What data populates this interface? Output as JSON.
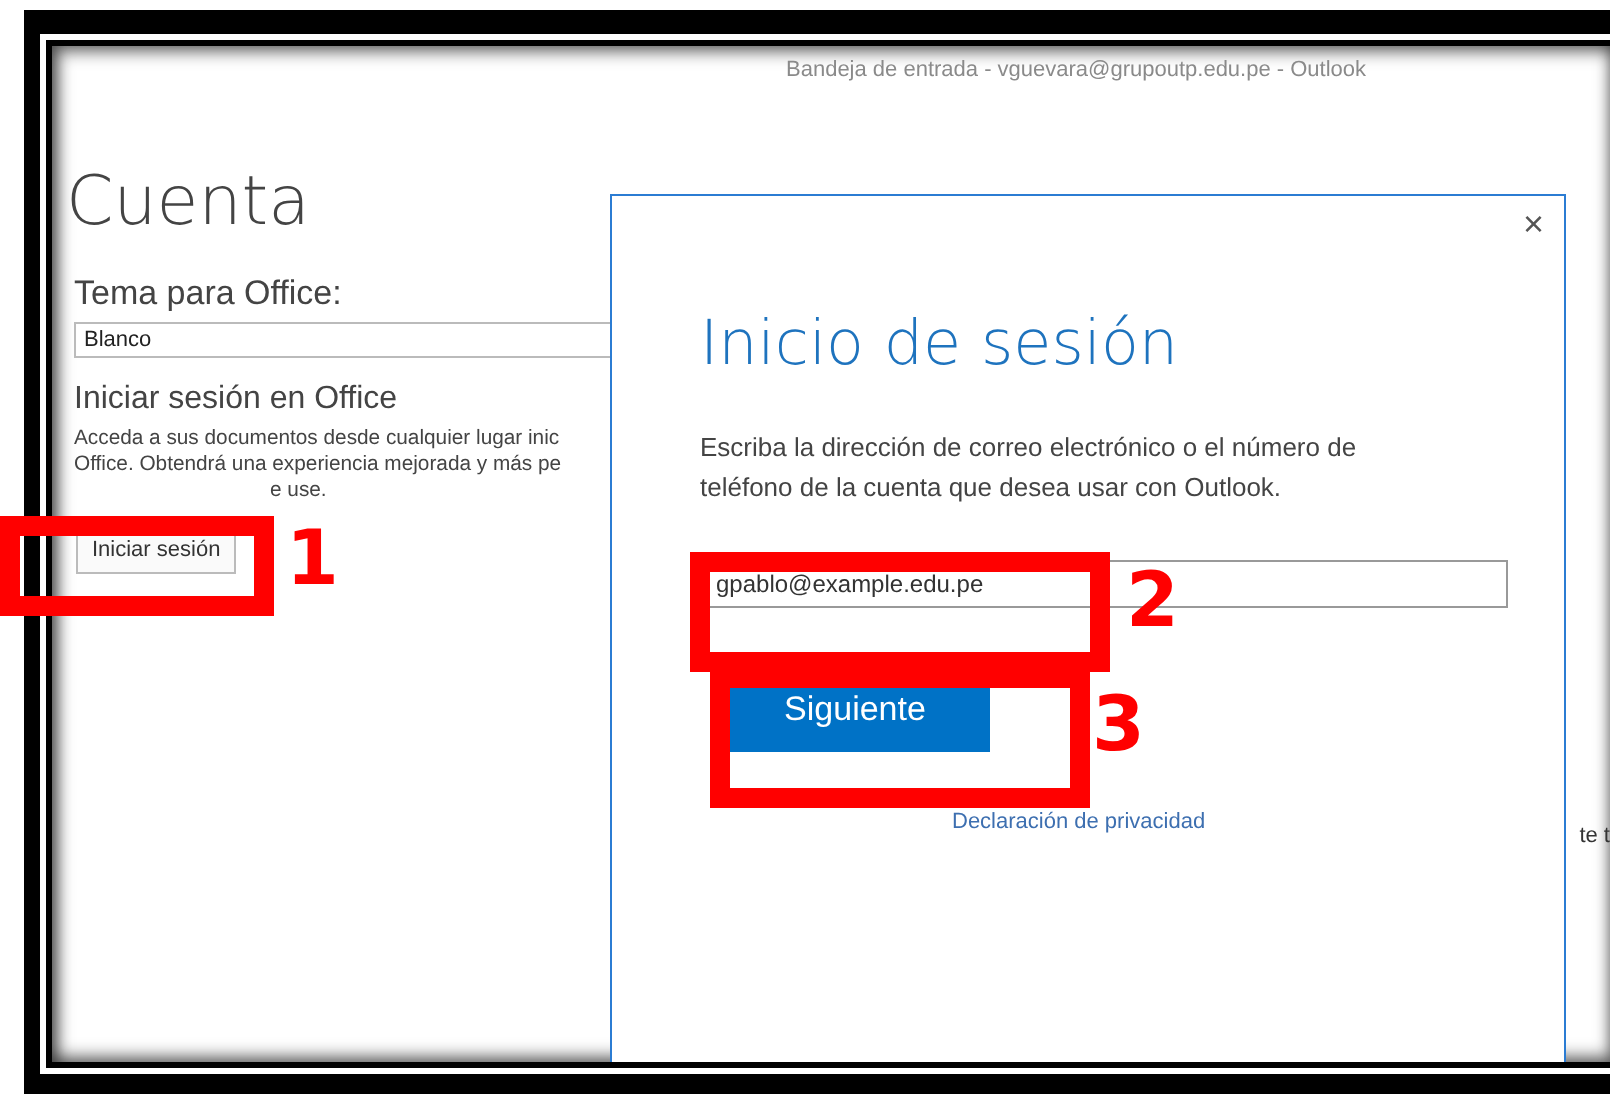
{
  "window": {
    "title": "Bandeja de entrada - vguevara@grupoutp.edu.pe - Outlook"
  },
  "account": {
    "heading": "Cuenta",
    "theme_label": "Tema para Office:",
    "theme_value": "Blanco",
    "signin_heading": "Iniciar sesión en Office",
    "signin_text_lines": [
      "Acceda a sus documentos desde cualquier lugar inic",
      "Office. Obtendrá una experiencia mejorada y más pe",
      "e use."
    ],
    "signin_button": "Iniciar sesión",
    "clipped_text": "te t"
  },
  "dialog": {
    "close": "×",
    "title": "Inicio de sesión",
    "description": "Escriba la dirección de correo electrónico o el número de teléfono de la cuenta que desea usar con Outlook.",
    "email": {
      "value": "gpablo@example.edu.pe"
    },
    "next_button": "Siguiente",
    "privacy_link": "Declaración de privacidad"
  },
  "annotations": [
    {
      "label": "1"
    },
    {
      "label": "2"
    },
    {
      "label": "3"
    }
  ]
}
